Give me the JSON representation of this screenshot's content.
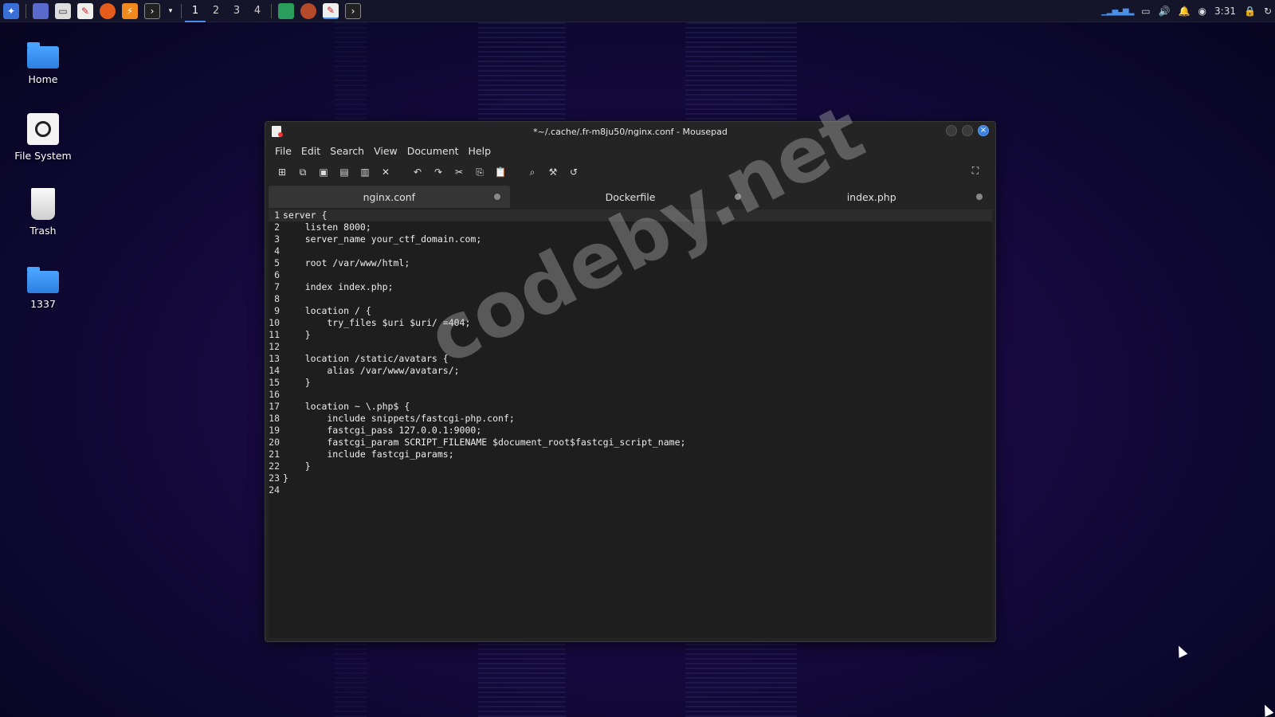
{
  "taskbar": {
    "workspaces": [
      "1",
      "2",
      "3",
      "4"
    ],
    "active_workspace": 0,
    "clock": "3:31"
  },
  "desktop": {
    "icons": [
      {
        "label": "Home",
        "icon": "home-folder-icon"
      },
      {
        "label": "File System",
        "icon": "filesystem-icon"
      },
      {
        "label": "Trash",
        "icon": "trash-icon"
      },
      {
        "label": "1337",
        "icon": "folder-icon"
      }
    ]
  },
  "window": {
    "title": "*~/.cache/.fr-m8ju50/nginx.conf - Mousepad",
    "menu": [
      "File",
      "Edit",
      "Search",
      "View",
      "Document",
      "Help"
    ],
    "tabs": [
      {
        "label": "nginx.conf",
        "active": true
      },
      {
        "label": "Dockerfile",
        "active": false
      },
      {
        "label": "index.php",
        "active": false
      }
    ],
    "lines": [
      "server {",
      "    listen 8000;",
      "    server_name your_ctf_domain.com;",
      "",
      "    root /var/www/html;",
      "",
      "    index index.php;",
      "",
      "    location / {",
      "        try_files $uri $uri/ =404;",
      "    }",
      "",
      "    location /static/avatars {",
      "        alias /var/www/avatars/;",
      "    }",
      "",
      "    location ~ \\.php$ {",
      "        include snippets/fastcgi-php.conf;",
      "        fastcgi_pass 127.0.0.1:9000;",
      "        fastcgi_param SCRIPT_FILENAME $document_root$fastcgi_script_name;",
      "        include fastcgi_params;",
      "    }",
      "}",
      ""
    ]
  },
  "watermark": "codeby.net"
}
